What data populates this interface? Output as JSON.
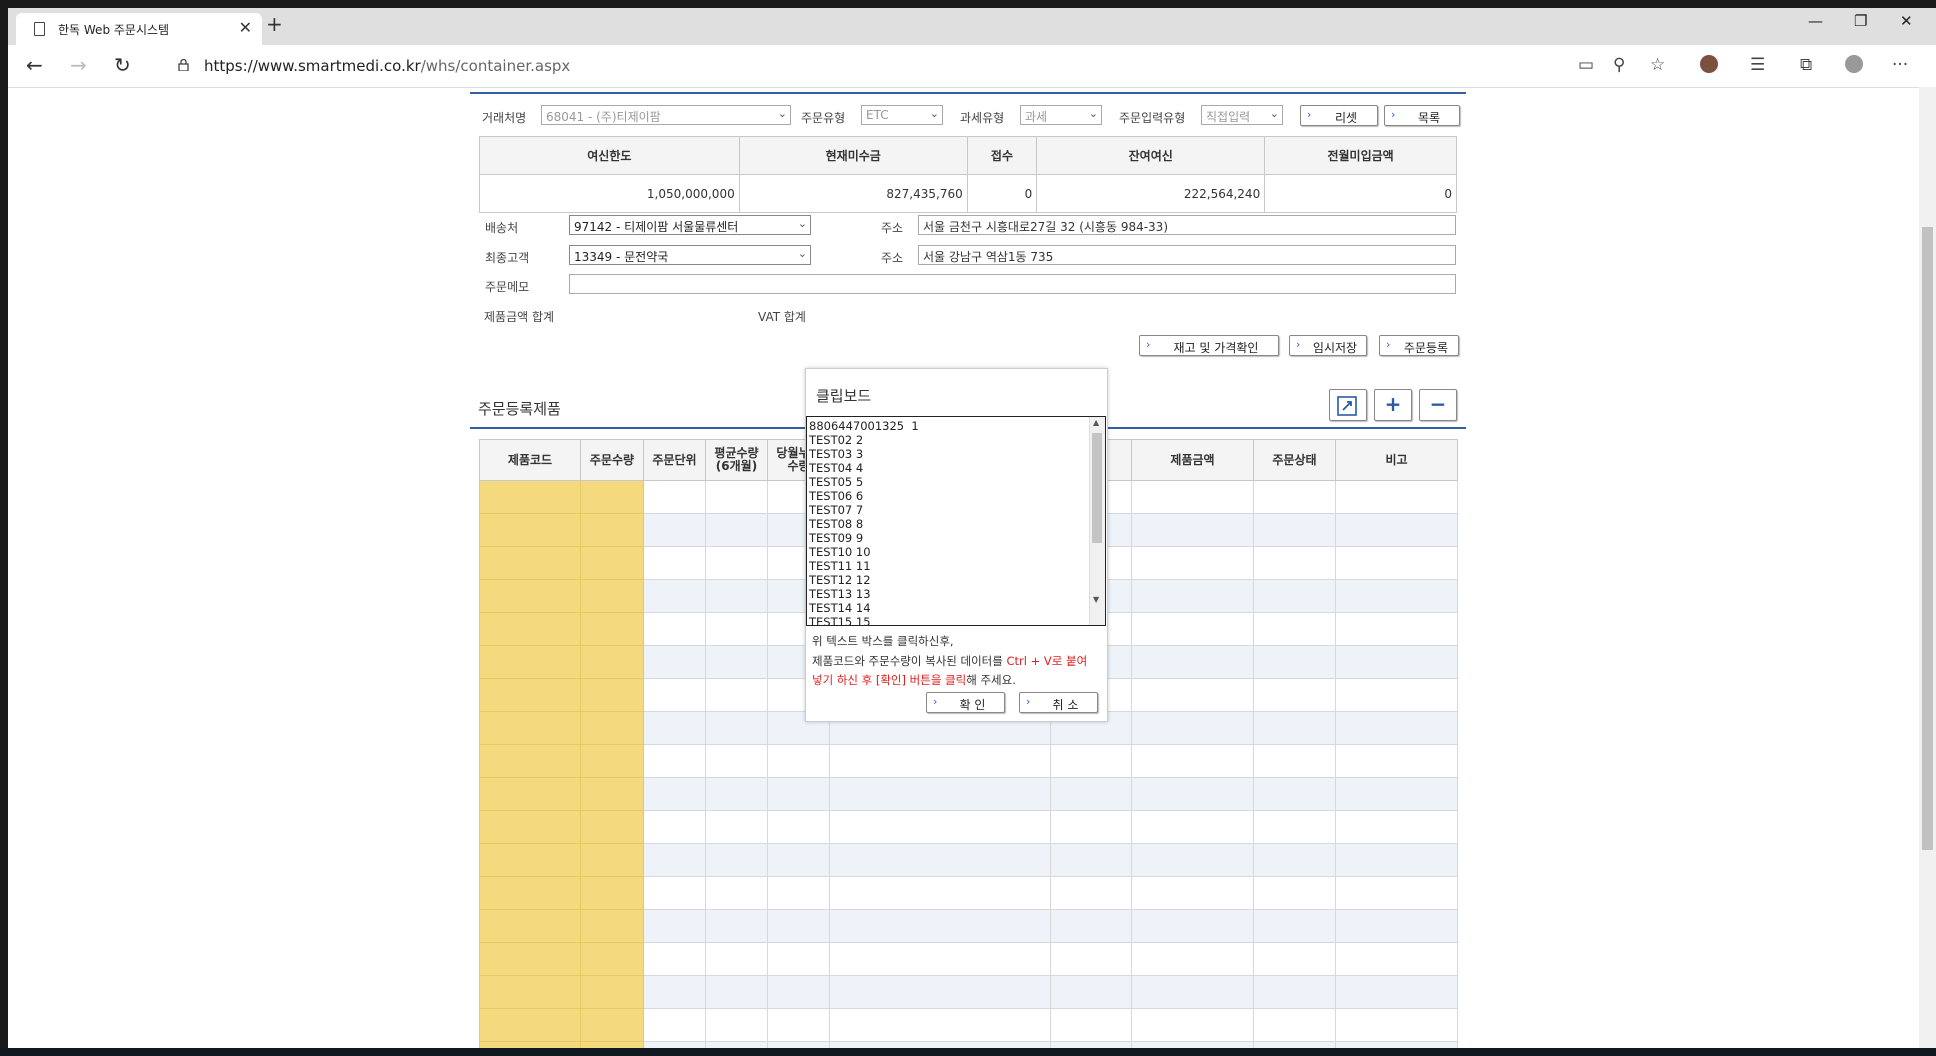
{
  "browser": {
    "tab_title": "한독 Web 주문시스템",
    "url_host": "https://www.smartmedi.co.kr",
    "url_path": "/whs/container.aspx"
  },
  "filters": {
    "customer_label": "거래처명",
    "customer_value": "68041 - (주)티제이팜",
    "order_type_label": "주문유형",
    "order_type_value": "ETC",
    "tax_type_label": "과세유형",
    "tax_type_value": "과세",
    "input_type_label": "주문입력유형",
    "input_type_value": "직접입력",
    "reset_label": "리셋",
    "list_label": "목록"
  },
  "summary": {
    "headers": [
      "여신한도",
      "현재미수금",
      "접수",
      "잔여여신",
      "전월미입금액"
    ],
    "values": [
      "1,050,000,000",
      "827,435,760",
      "0",
      "222,564,240",
      "0"
    ]
  },
  "shipping": {
    "ship_label": "배송처",
    "ship_value": "97142 - 티제이팜 서울물류센터",
    "ship_addr_label": "주소",
    "ship_addr": "서울 금천구 시흥대로27길 32 (시흥동 984-33)",
    "final_label": "최종고객",
    "final_value": "13349 - 문전약국",
    "final_addr_label": "주소",
    "final_addr": "서울 강남구 역삼1동 735",
    "memo_label": "주문메모",
    "product_total_label": "제품금액 합계",
    "vat_total_label": "VAT 합계"
  },
  "actions": {
    "stock_price_label": "재고 및 가격확인",
    "temp_save_label": "임시저장",
    "order_register_label": "주문등록"
  },
  "order_section": {
    "title": "주문등록제품",
    "columns": [
      "제품코드",
      "주문수량",
      "주문단위",
      "평균수량\n(6개월)",
      "당월누적\n수량",
      "",
      "제품금액",
      "주문상태",
      "비고"
    ]
  },
  "clipboard_popup": {
    "title": "클립보드",
    "text": "8806447001325  1\nTEST02 2\nTEST03 3\nTEST04 4\nTEST05 5\nTEST06 6\nTEST07 7\nTEST08 8\nTEST09 9\nTEST10 10\nTEST11 11\nTEST12 12\nTEST13 13\nTEST14 14\nTEST15 15",
    "msg1": "위 텍스트 박스를 클릭하신후,",
    "msg2a": "제품코드와 주문수량이  복사된 데이터를 ",
    "msg2b": "Ctrl + V로 붙여",
    "msg3a": "넣기 하신 후 [확인] 버튼을 클릭",
    "msg3b": "해 주세요.",
    "confirm_label": "확 인",
    "cancel_label": "취 소"
  }
}
